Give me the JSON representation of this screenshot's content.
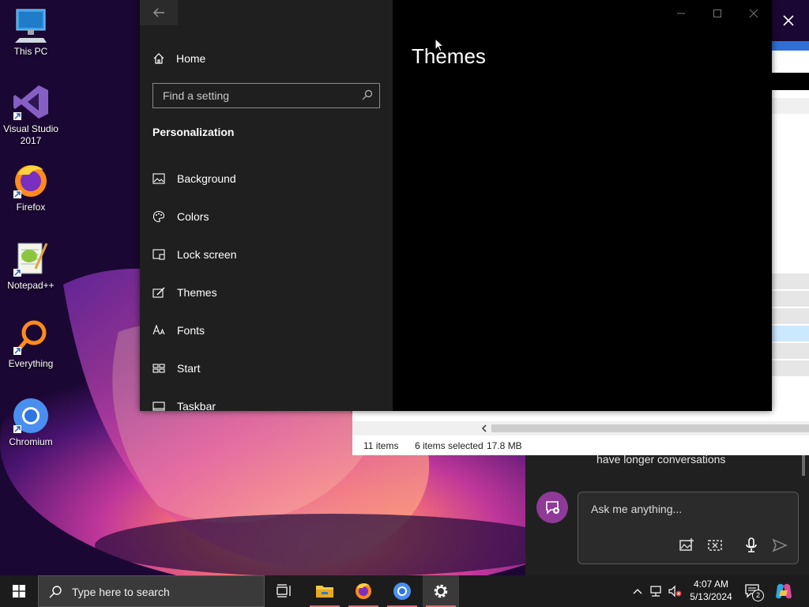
{
  "desktop": {
    "icons": [
      {
        "label": "This PC"
      },
      {
        "label": "Visual Studio 2017"
      },
      {
        "label": "Firefox"
      },
      {
        "label": "Notepad++"
      },
      {
        "label": "Everything"
      },
      {
        "label": "Chromium"
      }
    ]
  },
  "explorer": {
    "status_items": "11 items",
    "status_selected": "6 items selected",
    "status_size": "17.8 MB"
  },
  "chat": {
    "hint": "have longer conversations",
    "placeholder": "Ask me anything..."
  },
  "settings": {
    "nav": {
      "home": "Home",
      "search_placeholder": "Find a setting",
      "section": "Personalization",
      "items": [
        {
          "label": "Background"
        },
        {
          "label": "Colors"
        },
        {
          "label": "Lock screen"
        },
        {
          "label": "Themes"
        },
        {
          "label": "Fonts"
        },
        {
          "label": "Start"
        },
        {
          "label": "Taskbar"
        }
      ]
    },
    "page_title": "Themes"
  },
  "taskbar": {
    "search_placeholder": "Type here to search",
    "time": "4:07 AM",
    "date": "5/13/2024",
    "notification_count": "2"
  },
  "colors": {
    "accent_pink": "#e86a6a",
    "nav_bg": "#1f1f1f",
    "content_bg": "#000000"
  }
}
